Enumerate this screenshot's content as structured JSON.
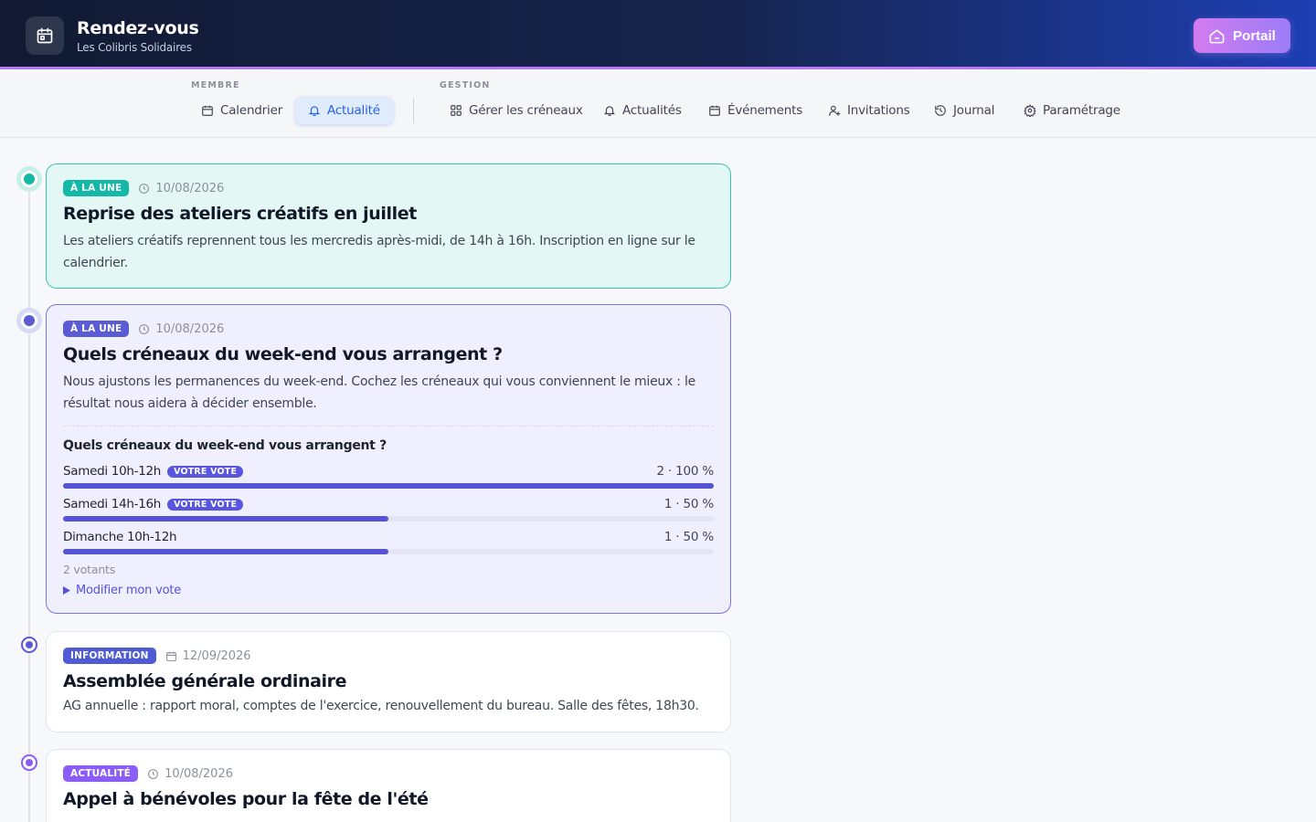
{
  "header": {
    "title": "Rendez-vous",
    "subtitle": "Les Colibris Solidaires",
    "portal_label": "Portail"
  },
  "nav": {
    "member_label": "MEMBRE",
    "management_label": "GESTION",
    "member_items": [
      {
        "label": "Calendrier",
        "icon": "calendar-icon"
      },
      {
        "label": "Actualité",
        "icon": "bell-icon",
        "active": true
      }
    ],
    "management_items": [
      {
        "label": "Gérer les créneaux",
        "icon": "grid-icon"
      },
      {
        "label": "Actualités",
        "icon": "bell-icon"
      },
      {
        "label": "Événements",
        "icon": "calendar-icon"
      },
      {
        "label": "Invitations",
        "icon": "user-plus-icon"
      },
      {
        "label": "Journal",
        "icon": "history-icon"
      },
      {
        "label": "Paramétrage",
        "icon": "gear-icon"
      }
    ]
  },
  "posts": [
    {
      "badge": "À LA UNE",
      "badge_color": "#14b8a6",
      "date": "10/08/2026",
      "date_icon": "clock-icon",
      "title": "Reprise des ateliers créatifs en juillet",
      "body": "Les ateliers créatifs reprennent tous les mercredis après-midi, de 14h à 16h. Inscription en ligne sur le calendrier."
    },
    {
      "badge": "À LA UNE",
      "badge_color": "#5b5bd6",
      "date": "10/08/2026",
      "date_icon": "clock-icon",
      "title": "Quels créneaux du week-end vous arrangent ?",
      "body": "Nous ajustons les permanences du week-end. Cochez les créneaux qui vous conviennent le mieux : le résultat nous aidera à décider ensemble.",
      "poll": {
        "question": "Quels créneaux du week-end vous arrangent ?",
        "your_vote_label": "VOTRE VOTE",
        "options": [
          {
            "label": "Samedi 10h-12h",
            "count": "2 · 100 %",
            "percent": 100,
            "your_vote": true
          },
          {
            "label": "Samedi 14h-16h",
            "count": "1 · 50 %",
            "percent": 50,
            "your_vote": true
          },
          {
            "label": "Dimanche 10h-12h",
            "count": "1 · 50 %",
            "percent": 50,
            "your_vote": false
          }
        ],
        "voters": "2 votants",
        "modify_label": "Modifier mon vote"
      }
    },
    {
      "badge": "INFORMATION",
      "badge_color": "#4f5bd5",
      "date": "12/09/2026",
      "date_icon": "calendar-icon",
      "title": "Assemblée générale ordinaire",
      "body": "AG annuelle : rapport moral, comptes de l'exercice, renouvellement du bureau. Salle des fêtes, 18h30."
    },
    {
      "badge": "ACTUALITÉ",
      "badge_color": "#8b5cf6",
      "date": "10/08/2026",
      "date_icon": "clock-icon",
      "title": "Appel à bénévoles pour la fête de l'été"
    }
  ],
  "colors": {
    "accent": "#2563eb",
    "teal": "#14b8a6",
    "violet": "#5452db"
  }
}
